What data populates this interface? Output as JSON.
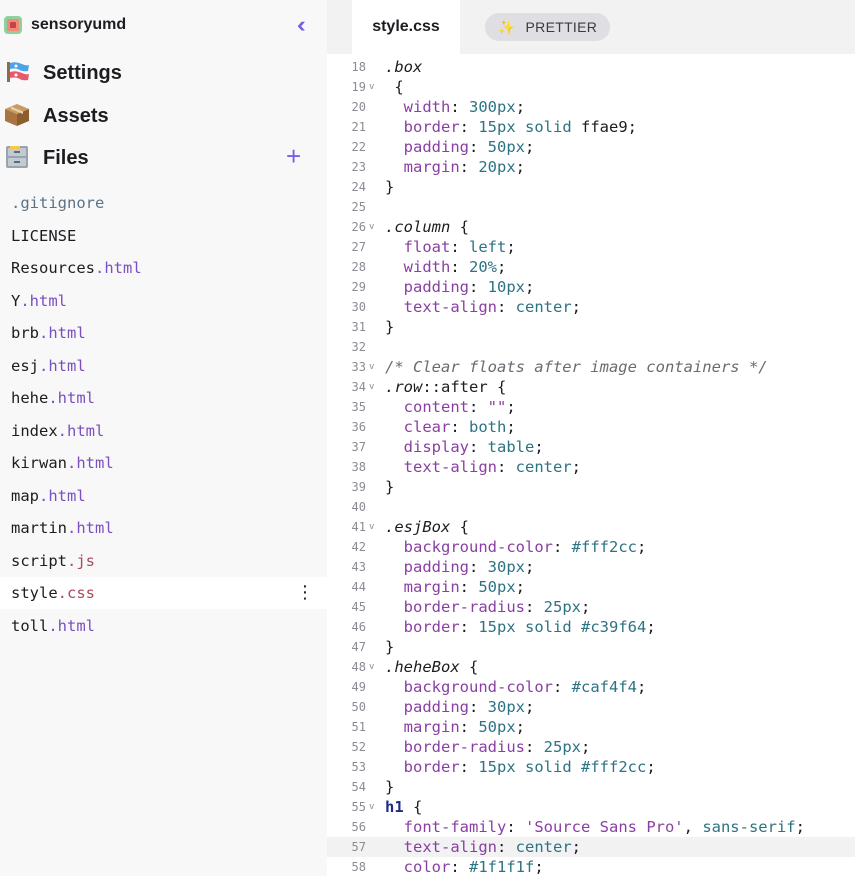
{
  "project": {
    "name": "sensoryumd"
  },
  "nav": {
    "settings": "Settings",
    "assets": "Assets",
    "files": "Files"
  },
  "files": [
    {
      "base": "",
      "ext": ".gitignore",
      "ext_class": "ext-gitignore"
    },
    {
      "base": "LICENSE",
      "ext": "",
      "ext_class": ""
    },
    {
      "base": "Resources",
      "ext": ".html",
      "ext_class": "ext-html"
    },
    {
      "base": "Y",
      "ext": ".html",
      "ext_class": "ext-html"
    },
    {
      "base": "brb",
      "ext": ".html",
      "ext_class": "ext-html"
    },
    {
      "base": "esj",
      "ext": ".html",
      "ext_class": "ext-html"
    },
    {
      "base": "hehe",
      "ext": ".html",
      "ext_class": "ext-html"
    },
    {
      "base": "index",
      "ext": ".html",
      "ext_class": "ext-html"
    },
    {
      "base": "kirwan",
      "ext": ".html",
      "ext_class": "ext-html"
    },
    {
      "base": "map",
      "ext": ".html",
      "ext_class": "ext-html"
    },
    {
      "base": "martin",
      "ext": ".html",
      "ext_class": "ext-html"
    },
    {
      "base": "script",
      "ext": ".js",
      "ext_class": "ext-js"
    },
    {
      "base": "style",
      "ext": ".css",
      "ext_class": "ext-css",
      "active": true
    },
    {
      "base": "toll",
      "ext": ".html",
      "ext_class": "ext-html"
    }
  ],
  "editor": {
    "tab_label": "style.css",
    "prettier_label": "PRETTIER",
    "highlight_line": 57,
    "lines": [
      {
        "n": "18",
        "fold": false,
        "tokens": [
          [
            "sel",
            ".box"
          ]
        ]
      },
      {
        "n": "19",
        "fold": true,
        "tokens": [
          [
            "punc",
            " {"
          ]
        ]
      },
      {
        "n": "20",
        "fold": false,
        "tokens": [
          [
            "punc",
            "  "
          ],
          [
            "prop",
            "width"
          ],
          [
            "punc",
            ": "
          ],
          [
            "val",
            "300px"
          ],
          [
            "punc",
            ";"
          ]
        ]
      },
      {
        "n": "21",
        "fold": false,
        "tokens": [
          [
            "punc",
            "  "
          ],
          [
            "prop",
            "border"
          ],
          [
            "punc",
            ": "
          ],
          [
            "val",
            "15px solid"
          ],
          [
            "punc",
            " ffae9;"
          ]
        ]
      },
      {
        "n": "22",
        "fold": false,
        "tokens": [
          [
            "punc",
            "  "
          ],
          [
            "prop",
            "padding"
          ],
          [
            "punc",
            ": "
          ],
          [
            "val",
            "50px"
          ],
          [
            "punc",
            ";"
          ]
        ]
      },
      {
        "n": "23",
        "fold": false,
        "tokens": [
          [
            "punc",
            "  "
          ],
          [
            "prop",
            "margin"
          ],
          [
            "punc",
            ": "
          ],
          [
            "val",
            "20px"
          ],
          [
            "punc",
            ";"
          ]
        ]
      },
      {
        "n": "24",
        "fold": false,
        "tokens": [
          [
            "punc",
            "}"
          ]
        ]
      },
      {
        "n": "25",
        "fold": false,
        "tokens": []
      },
      {
        "n": "26",
        "fold": true,
        "tokens": [
          [
            "sel",
            ".column"
          ],
          [
            "punc",
            " {"
          ]
        ]
      },
      {
        "n": "27",
        "fold": false,
        "tokens": [
          [
            "punc",
            "  "
          ],
          [
            "prop",
            "float"
          ],
          [
            "punc",
            ": "
          ],
          [
            "val",
            "left"
          ],
          [
            "punc",
            ";"
          ]
        ]
      },
      {
        "n": "28",
        "fold": false,
        "tokens": [
          [
            "punc",
            "  "
          ],
          [
            "prop",
            "width"
          ],
          [
            "punc",
            ": "
          ],
          [
            "val",
            "20%"
          ],
          [
            "punc",
            ";"
          ]
        ]
      },
      {
        "n": "29",
        "fold": false,
        "tokens": [
          [
            "punc",
            "  "
          ],
          [
            "prop",
            "padding"
          ],
          [
            "punc",
            ": "
          ],
          [
            "val",
            "10px"
          ],
          [
            "punc",
            ";"
          ]
        ]
      },
      {
        "n": "30",
        "fold": false,
        "tokens": [
          [
            "punc",
            "  "
          ],
          [
            "prop",
            "text-align"
          ],
          [
            "punc",
            ": "
          ],
          [
            "val",
            "center"
          ],
          [
            "punc",
            ";"
          ]
        ]
      },
      {
        "n": "31",
        "fold": false,
        "tokens": [
          [
            "punc",
            "}"
          ]
        ]
      },
      {
        "n": "32",
        "fold": false,
        "tokens": []
      },
      {
        "n": "33",
        "fold": true,
        "tokens": [
          [
            "cmt",
            "/* Clear floats after image containers */"
          ]
        ]
      },
      {
        "n": "34",
        "fold": true,
        "tokens": [
          [
            "sel",
            ".row"
          ],
          [
            "punc",
            "::after {"
          ]
        ]
      },
      {
        "n": "35",
        "fold": false,
        "tokens": [
          [
            "punc",
            "  "
          ],
          [
            "prop",
            "content"
          ],
          [
            "punc",
            ": "
          ],
          [
            "str",
            "\"\""
          ],
          [
            "punc",
            ";"
          ]
        ]
      },
      {
        "n": "36",
        "fold": false,
        "tokens": [
          [
            "punc",
            "  "
          ],
          [
            "prop",
            "clear"
          ],
          [
            "punc",
            ": "
          ],
          [
            "val",
            "both"
          ],
          [
            "punc",
            ";"
          ]
        ]
      },
      {
        "n": "37",
        "fold": false,
        "tokens": [
          [
            "punc",
            "  "
          ],
          [
            "prop",
            "display"
          ],
          [
            "punc",
            ": "
          ],
          [
            "val",
            "table"
          ],
          [
            "punc",
            ";"
          ]
        ]
      },
      {
        "n": "38",
        "fold": false,
        "tokens": [
          [
            "punc",
            "  "
          ],
          [
            "prop",
            "text-align"
          ],
          [
            "punc",
            ": "
          ],
          [
            "val",
            "center"
          ],
          [
            "punc",
            ";"
          ]
        ]
      },
      {
        "n": "39",
        "fold": false,
        "tokens": [
          [
            "punc",
            "}"
          ]
        ]
      },
      {
        "n": "40",
        "fold": false,
        "tokens": []
      },
      {
        "n": "41",
        "fold": true,
        "tokens": [
          [
            "sel",
            ".esjBox"
          ],
          [
            "punc",
            " {"
          ]
        ]
      },
      {
        "n": "42",
        "fold": false,
        "tokens": [
          [
            "punc",
            "  "
          ],
          [
            "prop",
            "background-color"
          ],
          [
            "punc",
            ": "
          ],
          [
            "val",
            "#fff2cc"
          ],
          [
            "punc",
            ";"
          ]
        ]
      },
      {
        "n": "43",
        "fold": false,
        "tokens": [
          [
            "punc",
            "  "
          ],
          [
            "prop",
            "padding"
          ],
          [
            "punc",
            ": "
          ],
          [
            "val",
            "30px"
          ],
          [
            "punc",
            ";"
          ]
        ]
      },
      {
        "n": "44",
        "fold": false,
        "tokens": [
          [
            "punc",
            "  "
          ],
          [
            "prop",
            "margin"
          ],
          [
            "punc",
            ": "
          ],
          [
            "val",
            "50px"
          ],
          [
            "punc",
            ";"
          ]
        ]
      },
      {
        "n": "45",
        "fold": false,
        "tokens": [
          [
            "punc",
            "  "
          ],
          [
            "prop",
            "border-radius"
          ],
          [
            "punc",
            ": "
          ],
          [
            "val",
            "25px"
          ],
          [
            "punc",
            ";"
          ]
        ]
      },
      {
        "n": "46",
        "fold": false,
        "tokens": [
          [
            "punc",
            "  "
          ],
          [
            "prop",
            "border"
          ],
          [
            "punc",
            ": "
          ],
          [
            "val",
            "15px solid #c39f64"
          ],
          [
            "punc",
            ";"
          ]
        ]
      },
      {
        "n": "47",
        "fold": false,
        "tokens": [
          [
            "punc",
            "}"
          ]
        ]
      },
      {
        "n": "48",
        "fold": true,
        "tokens": [
          [
            "sel",
            ".heheBox"
          ],
          [
            "punc",
            " {"
          ]
        ]
      },
      {
        "n": "49",
        "fold": false,
        "tokens": [
          [
            "punc",
            "  "
          ],
          [
            "prop",
            "background-color"
          ],
          [
            "punc",
            ": "
          ],
          [
            "val",
            "#caf4f4"
          ],
          [
            "punc",
            ";"
          ]
        ]
      },
      {
        "n": "50",
        "fold": false,
        "tokens": [
          [
            "punc",
            "  "
          ],
          [
            "prop",
            "padding"
          ],
          [
            "punc",
            ": "
          ],
          [
            "val",
            "30px"
          ],
          [
            "punc",
            ";"
          ]
        ]
      },
      {
        "n": "51",
        "fold": false,
        "tokens": [
          [
            "punc",
            "  "
          ],
          [
            "prop",
            "margin"
          ],
          [
            "punc",
            ": "
          ],
          [
            "val",
            "50px"
          ],
          [
            "punc",
            ";"
          ]
        ]
      },
      {
        "n": "52",
        "fold": false,
        "tokens": [
          [
            "punc",
            "  "
          ],
          [
            "prop",
            "border-radius"
          ],
          [
            "punc",
            ": "
          ],
          [
            "val",
            "25px"
          ],
          [
            "punc",
            ";"
          ]
        ]
      },
      {
        "n": "53",
        "fold": false,
        "tokens": [
          [
            "punc",
            "  "
          ],
          [
            "prop",
            "border"
          ],
          [
            "punc",
            ": "
          ],
          [
            "val",
            "15px solid #fff2cc"
          ],
          [
            "punc",
            ";"
          ]
        ]
      },
      {
        "n": "54",
        "fold": false,
        "tokens": [
          [
            "punc",
            "}"
          ]
        ]
      },
      {
        "n": "55",
        "fold": true,
        "tokens": [
          [
            "tag",
            "h1"
          ],
          [
            "punc",
            " {"
          ]
        ]
      },
      {
        "n": "56",
        "fold": false,
        "tokens": [
          [
            "punc",
            "  "
          ],
          [
            "prop",
            "font-family"
          ],
          [
            "punc",
            ": "
          ],
          [
            "str",
            "'Source Sans Pro'"
          ],
          [
            "punc",
            ", "
          ],
          [
            "val",
            "sans-serif"
          ],
          [
            "punc",
            ";"
          ]
        ]
      },
      {
        "n": "57",
        "fold": false,
        "tokens": [
          [
            "punc",
            "  "
          ],
          [
            "prop",
            "text-align"
          ],
          [
            "punc",
            ": "
          ],
          [
            "val",
            "center"
          ],
          [
            "punc",
            ";"
          ]
        ]
      },
      {
        "n": "58",
        "fold": false,
        "tokens": [
          [
            "punc",
            "  "
          ],
          [
            "prop",
            "color"
          ],
          [
            "punc",
            ": "
          ],
          [
            "val",
            "#1f1f1f"
          ],
          [
            "punc",
            ";"
          ]
        ]
      }
    ]
  }
}
